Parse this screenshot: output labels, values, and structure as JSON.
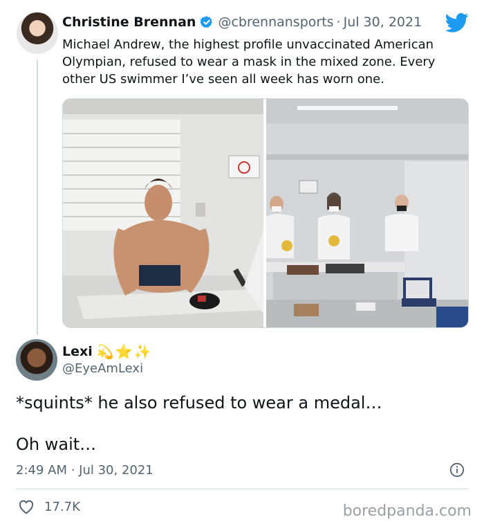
{
  "quoted": {
    "name": "Christine Brennan",
    "handle": "@cbrennansports",
    "separator": "·",
    "date": "Jul 30, 2021",
    "text": "Michael Andrew, the highest profile unvaccinated American Olympian, refused to wear a mask in the mixed zone. Every other US swimmer I’ve seen all week has worn one.",
    "verified": true,
    "icons": [
      "verified-badge-icon",
      "twitter-bird-icon"
    ],
    "accent": "#1d9bf0"
  },
  "reply": {
    "name": "Lexi",
    "emojis": "💫⭐✨",
    "handle": "@EyeAmLexi",
    "text_line1": "*squints* he also refused to wear a medal…",
    "text_line2": "Oh wait…",
    "timestamp": "2:49 AM · Jul 30, 2021",
    "likes": "17.7K",
    "icons": [
      "info-icon",
      "heart-icon"
    ]
  },
  "watermark": "boredpanda.com"
}
